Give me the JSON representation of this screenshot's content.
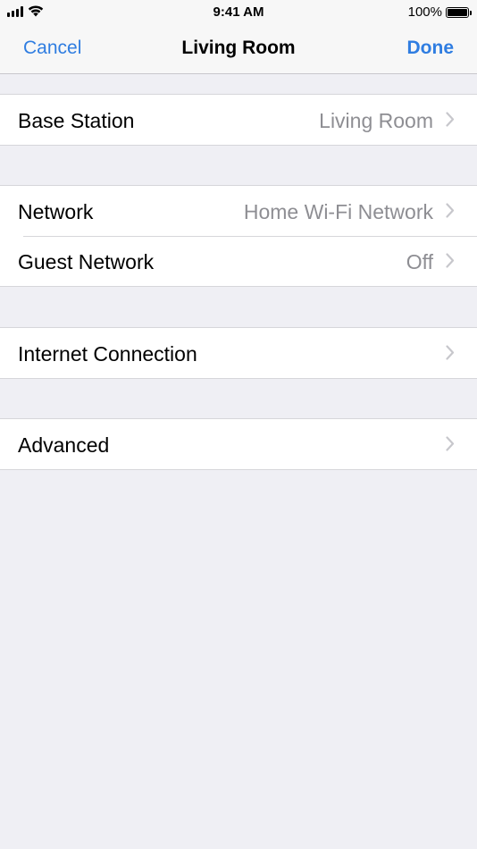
{
  "status_bar": {
    "time": "9:41 AM",
    "battery_text": "100%",
    "battery_level": 1.0,
    "signal_icon": "cellular-signal-icon",
    "wifi_icon": "wifi-icon"
  },
  "nav": {
    "cancel_label": "Cancel",
    "title": "Living Room",
    "done_label": "Done",
    "accent_color": "#2f7de1"
  },
  "sections": [
    {
      "rows": [
        {
          "label": "Base Station",
          "value": "Living Room"
        }
      ]
    },
    {
      "rows": [
        {
          "label": "Network",
          "value": "Home Wi-Fi Network"
        },
        {
          "label": "Guest Network",
          "value": "Off"
        }
      ]
    },
    {
      "rows": [
        {
          "label": "Internet Connection",
          "value": ""
        }
      ]
    },
    {
      "rows": [
        {
          "label": "Advanced",
          "value": ""
        }
      ]
    }
  ],
  "icons": {
    "chevron": "chevron-right-icon",
    "battery": "battery-icon"
  }
}
